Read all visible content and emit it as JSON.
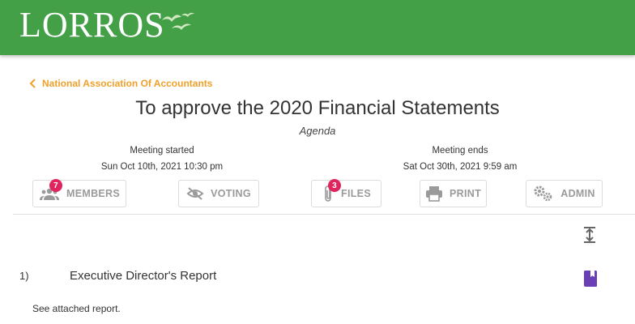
{
  "header": {
    "logo_text": "LORROS",
    "accent_color": "#43a047"
  },
  "breadcrumb": {
    "label": "National Association Of Accountants",
    "color": "#f0a02a"
  },
  "meeting": {
    "title": "To approve the 2020 Financial Statements",
    "subtitle": "Agenda",
    "started_label": "Meeting started",
    "started_value": "Sun Oct 10th, 2021 10:30 pm",
    "ends_label": "Meeting ends",
    "ends_value": "Sat Oct 30th, 2021 9:59 am"
  },
  "tabs": {
    "members": {
      "label": "MEMBERS",
      "badge": "7",
      "icon": "group-icon"
    },
    "voting": {
      "label": "VOTING",
      "icon": "eye-off-icon"
    },
    "files": {
      "label": "FILES",
      "badge": "3",
      "icon": "paperclip-icon"
    },
    "print": {
      "label": "PRINT",
      "icon": "printer-icon"
    },
    "admin": {
      "label": "ADMIN",
      "icon": "gears-icon"
    }
  },
  "agenda": {
    "items": [
      {
        "number": "1)",
        "title": "Executive Director's Report",
        "description": "See attached report.",
        "icon": "bookmark-icon",
        "icon_color": "#6a3fb5"
      }
    ]
  }
}
